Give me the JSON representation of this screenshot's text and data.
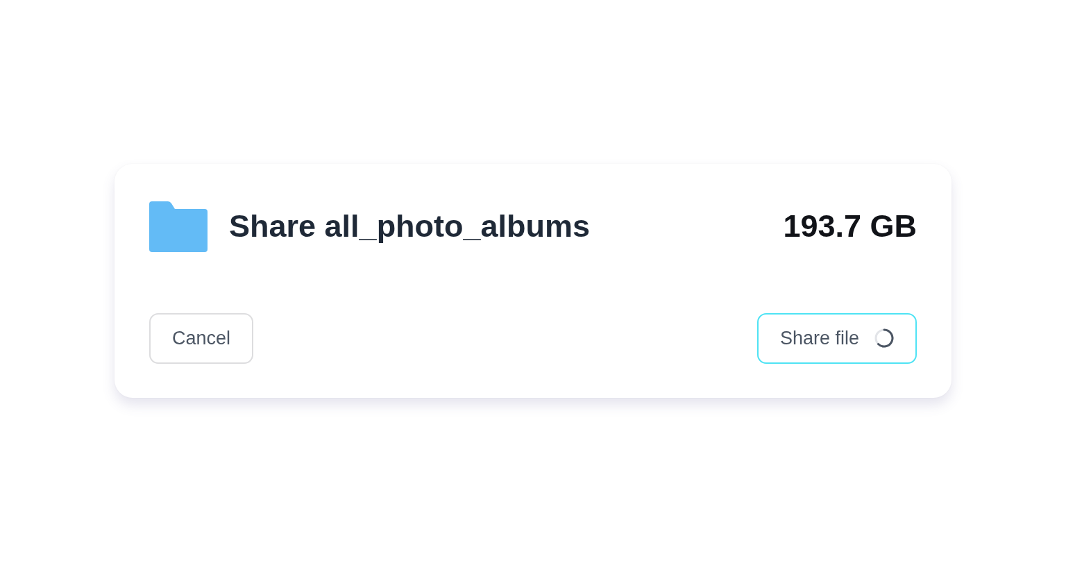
{
  "share_dialog": {
    "title": "Share all_photo_albums",
    "size": "193.7 GB",
    "buttons": [
      {
        "label": "Cancel",
        "focused": false,
        "loading": false
      },
      {
        "label": "Share file",
        "focused": true,
        "loading": true
      }
    ]
  }
}
